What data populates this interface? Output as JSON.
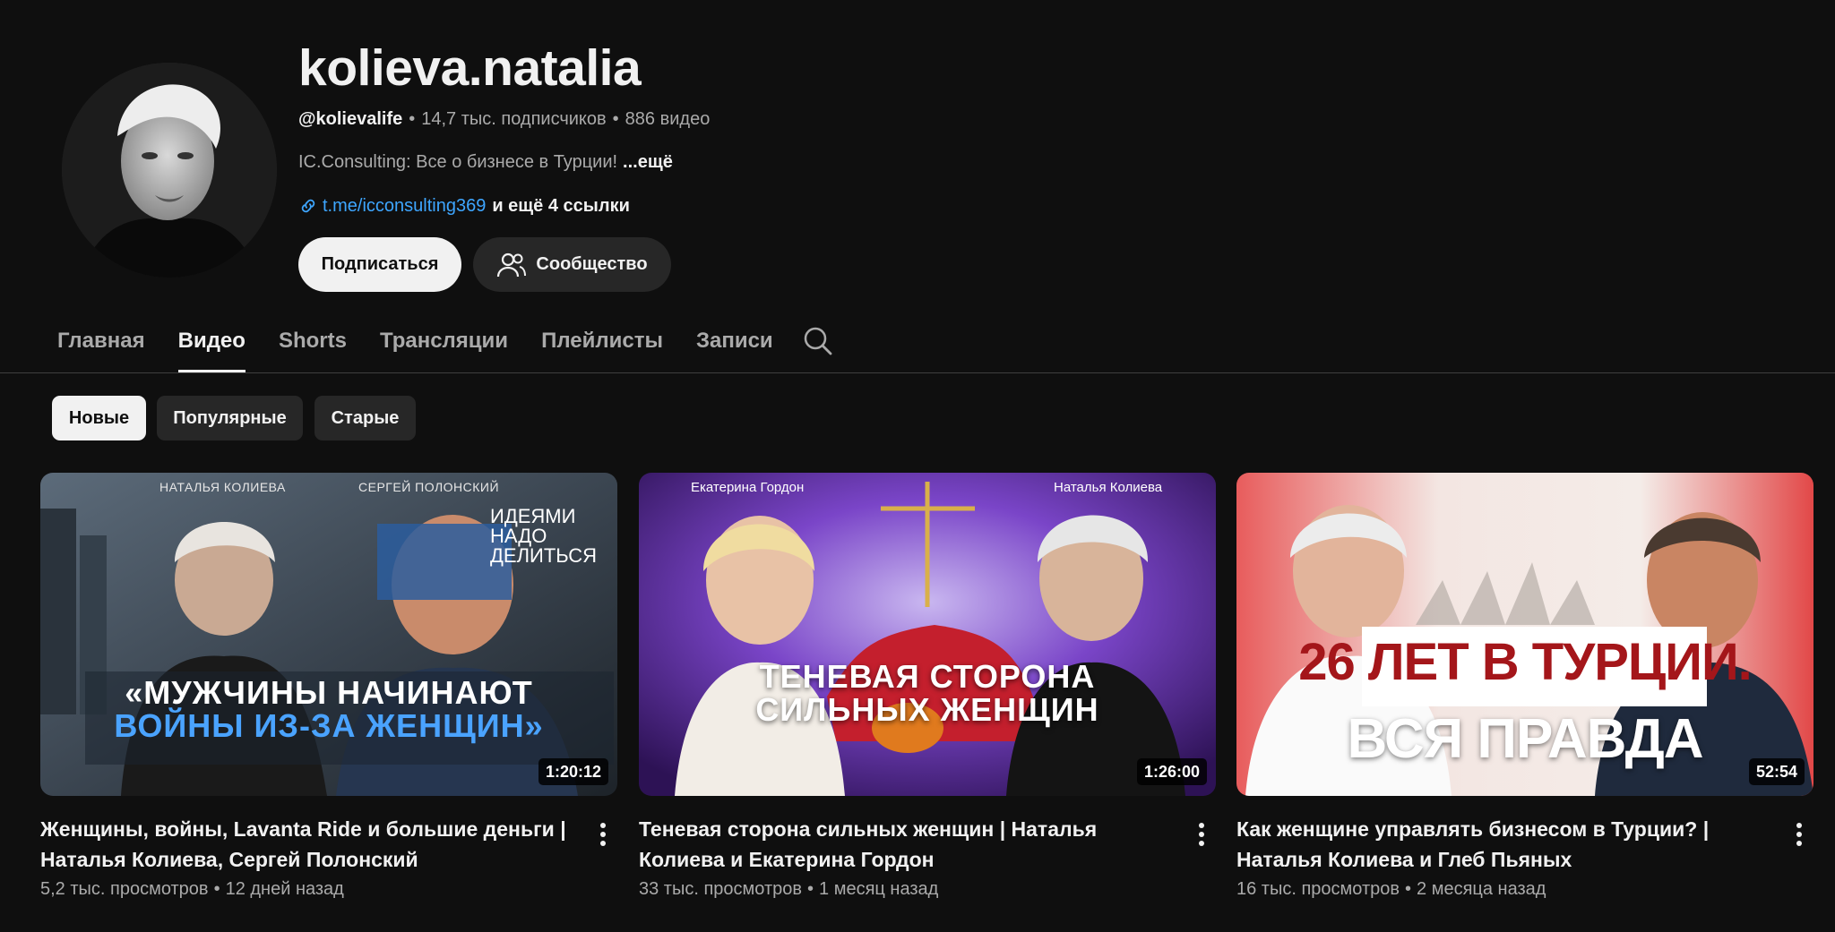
{
  "channel": {
    "name": "kolieva.natalia",
    "handle": "@kolievalife",
    "subscribers": "14,7 тыс. подписчиков",
    "video_count": "886 видео",
    "separator": "•",
    "description": "IC.Consulting: Все о бизнесе в Турции!",
    "description_more": "...ещё",
    "link": "t.me/icconsulting369",
    "more_links": "и ещё 4 ссылки",
    "subscribe_label": "Подписаться",
    "community_label": "Сообщество"
  },
  "tabs": [
    {
      "label": "Главная",
      "active": false
    },
    {
      "label": "Видео",
      "active": true
    },
    {
      "label": "Shorts",
      "active": false
    },
    {
      "label": "Трансляции",
      "active": false
    },
    {
      "label": "Плейлисты",
      "active": false
    },
    {
      "label": "Записи",
      "active": false
    }
  ],
  "chips": [
    {
      "label": "Новые",
      "selected": true
    },
    {
      "label": "Популярные",
      "selected": false
    },
    {
      "label": "Старые",
      "selected": false
    }
  ],
  "videos": [
    {
      "title": "Женщины, войны, Lavanta Ride и большие деньги | Наталья Колиева, Сергей Полонский",
      "duration": "1:20:12",
      "views": "5,2 тыс. просмотров",
      "age": "12 дней назад",
      "thumb": {
        "name_left": "НАТАЛЬЯ КОЛИЕВА",
        "name_right": "СЕРГЕЙ ПОЛОНСКИЙ",
        "tag_lines": [
          "ИДЕЯМИ",
          "НАДО",
          "ДЕЛИТЬСЯ"
        ],
        "headline_1": "«МУЖЧИНЫ НАЧИНАЮТ",
        "headline_2": "ВОЙНЫ ИЗ-ЗА ЖЕНЩИН»"
      }
    },
    {
      "title": "Теневая сторона сильных женщин | Наталья Колиева и Екатерина Гордон",
      "duration": "1:26:00",
      "views": "33 тыс. просмотров",
      "age": "1 месяц назад",
      "thumb": {
        "name_left": "Екатерина Гордон",
        "name_right": "Наталья Колиева",
        "headline_1": "ТЕНЕВАЯ СТОРОНА",
        "headline_2": "СИЛЬНЫХ ЖЕНЩИН"
      }
    },
    {
      "title": "Как женщине управлять бизнесом в Турции? | Наталья Колиева и Глеб Пьяных",
      "duration": "52:54",
      "views": "16 тыс. просмотров",
      "age": "2 месяца назад",
      "thumb": {
        "headline_1": "26 ЛЕТ В ТУРЦИИ.",
        "headline_2": "ВСЯ ПРАВДА"
      }
    }
  ],
  "colors": {
    "background": "#0f0f0f",
    "text_primary": "#f1f1f1",
    "text_secondary": "#aaaaaa",
    "link": "#3ea6ff",
    "chip_bg": "#272727"
  }
}
